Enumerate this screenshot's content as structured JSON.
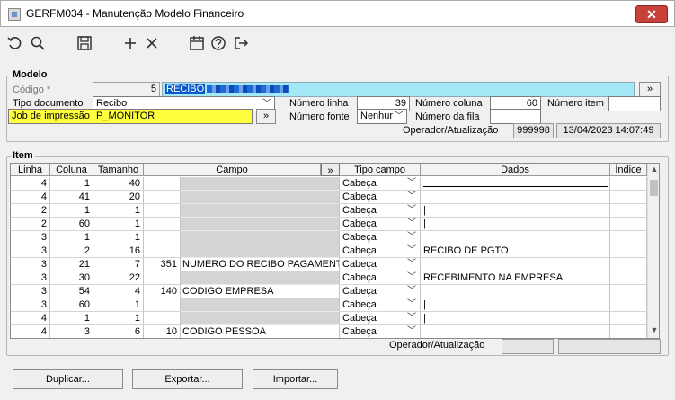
{
  "window": {
    "title": "GERFM034 - Manutenção Modelo Financeiro",
    "close_glyph": "✕"
  },
  "toolbar": {
    "icons": [
      "undo-icon",
      "search-icon",
      "save-icon",
      "add-icon",
      "delete-icon",
      "calendar-icon",
      "help-icon",
      "exit-icon"
    ]
  },
  "modelo": {
    "legend": "Modelo",
    "codigo_label": "Código *",
    "codigo_value": "5",
    "descricao_value": "RECIBO",
    "lookup_button": "»",
    "tipo_documento_label": "Tipo documento",
    "tipo_documento_value": "Recibo",
    "job_label": "Job de impressão",
    "job_value": "P_MONITOR",
    "job_button": "»",
    "numero_linha_label": "Número linha",
    "numero_linha_value": "39",
    "numero_fonte_label": "Número fonte",
    "numero_fonte_value": "Nenhur",
    "numero_coluna_label": "Número coluna",
    "numero_coluna_value": "60",
    "numero_fila_label": "Número da fila",
    "numero_fila_value": "",
    "numero_item_label": "Número item",
    "numero_item_value": "",
    "operador_label": "Operador/Atualização",
    "operador_value": "999998",
    "atualizacao_value": "13/04/2023 14:07:49"
  },
  "item": {
    "legend": "Item",
    "columns": {
      "linha": "Linha",
      "coluna": "Coluna",
      "tamanho": "Tamanho",
      "campo": "Campo",
      "campo_button": "»",
      "tipo_campo": "Tipo campo",
      "dados": "Dados",
      "indice": "Índice"
    },
    "rows": [
      {
        "linha": "4",
        "coluna": "1",
        "tamanho": "40",
        "campo_num": "",
        "campo_nome": "",
        "tipo": "Cabeça",
        "dados": "",
        "line": 206
      },
      {
        "linha": "4",
        "coluna": "41",
        "tamanho": "20",
        "campo_num": "",
        "campo_nome": "",
        "tipo": "Cabeça",
        "dados": "",
        "line": 118
      },
      {
        "linha": "2",
        "coluna": "1",
        "tamanho": "1",
        "campo_num": "",
        "campo_nome": "",
        "tipo": "Cabeça",
        "dados": "|",
        "line": 0
      },
      {
        "linha": "2",
        "coluna": "60",
        "tamanho": "1",
        "campo_num": "",
        "campo_nome": "",
        "tipo": "Cabeça",
        "dados": "|",
        "line": 0
      },
      {
        "linha": "3",
        "coluna": "1",
        "tamanho": "1",
        "campo_num": "",
        "campo_nome": "",
        "tipo": "Cabeça",
        "dados": "",
        "line": 0
      },
      {
        "linha": "3",
        "coluna": "2",
        "tamanho": "16",
        "campo_num": "",
        "campo_nome": "",
        "tipo": "Cabeça",
        "dados": "RECIBO DE PGTO",
        "line": 0
      },
      {
        "linha": "3",
        "coluna": "21",
        "tamanho": "7",
        "campo_num": "351",
        "campo_nome": "NUMERO DO RECIBO PAGAMENTO",
        "tipo": "Cabeça",
        "dados": "",
        "line": 0
      },
      {
        "linha": "3",
        "coluna": "30",
        "tamanho": "22",
        "campo_num": "",
        "campo_nome": "",
        "tipo": "Cabeça",
        "dados": "RECEBIMENTO NA EMPRESA",
        "line": 0
      },
      {
        "linha": "3",
        "coluna": "54",
        "tamanho": "4",
        "campo_num": "140",
        "campo_nome": "CODIGO EMPRESA",
        "tipo": "Cabeça",
        "dados": "",
        "line": 0
      },
      {
        "linha": "3",
        "coluna": "60",
        "tamanho": "1",
        "campo_num": "",
        "campo_nome": "",
        "tipo": "Cabeça",
        "dados": "|",
        "line": 0
      },
      {
        "linha": "4",
        "coluna": "1",
        "tamanho": "1",
        "campo_num": "",
        "campo_nome": "",
        "tipo": "Cabeça",
        "dados": "|",
        "line": 0
      },
      {
        "linha": "4",
        "coluna": "3",
        "tamanho": "6",
        "campo_num": "10",
        "campo_nome": "CODIGO PESSOA",
        "tipo": "Cabeça",
        "dados": "",
        "line": 0
      }
    ],
    "operador_label": "Operador/Atualização",
    "operador_value": "",
    "atualizacao_value": ""
  },
  "buttons": {
    "duplicar": "Duplicar...",
    "exportar": "Exportar...",
    "importar": "Importar..."
  }
}
